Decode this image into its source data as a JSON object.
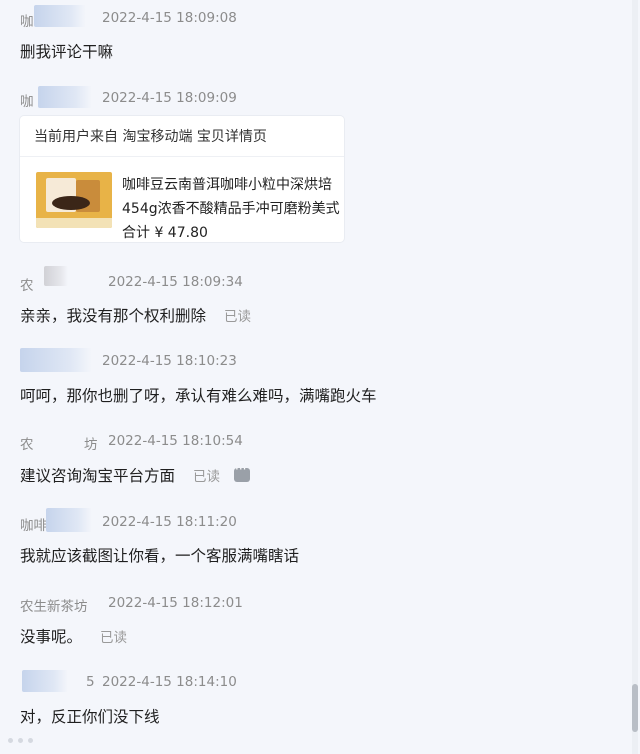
{
  "messages": [
    {
      "sender": "咖",
      "time": "2022-4-15 18:09:08",
      "text": "删我评论干嘛",
      "read": ""
    },
    {
      "sender": "咖",
      "time": "2022-4-15 18:09:09",
      "text": "",
      "read": ""
    },
    {
      "sender": "农",
      "time": "2022-4-15 18:09:34",
      "text": "亲亲，我没有那个权利删除",
      "read": "已读"
    },
    {
      "sender": "",
      "time": "2022-4-15 18:10:23",
      "text": "呵呵，那你也删了呀，承认有难么难吗，满嘴跑火车",
      "read": ""
    },
    {
      "sender": "农",
      "sender_tail": "坊",
      "time": "2022-4-15 18:10:54",
      "text": "建议咨询淘宝平台方面",
      "read": "已读"
    },
    {
      "sender": "咖啡",
      "time": "2022-4-15 18:11:20",
      "text": "我就应该截图让你看，一个客服满嘴瞎话",
      "read": ""
    },
    {
      "sender": "农生新茶坊",
      "time": "2022-4-15 18:12:01",
      "text": "没事呢。",
      "read": "已读"
    },
    {
      "sender": "",
      "sender_tail": "5",
      "time": "2022-4-15 18:14:10",
      "text": "对，反正你们没下线",
      "read": ""
    }
  ],
  "product_card": {
    "header": "当前用户来自 淘宝移动端 宝贝详情页",
    "line1": "咖啡豆云南普洱咖啡小粒中深烘培",
    "line2": "454g浓香不酸精品手冲可磨粉美式",
    "line3": "合计 ¥ 47.80"
  },
  "icons": {
    "more": "more-icon"
  }
}
